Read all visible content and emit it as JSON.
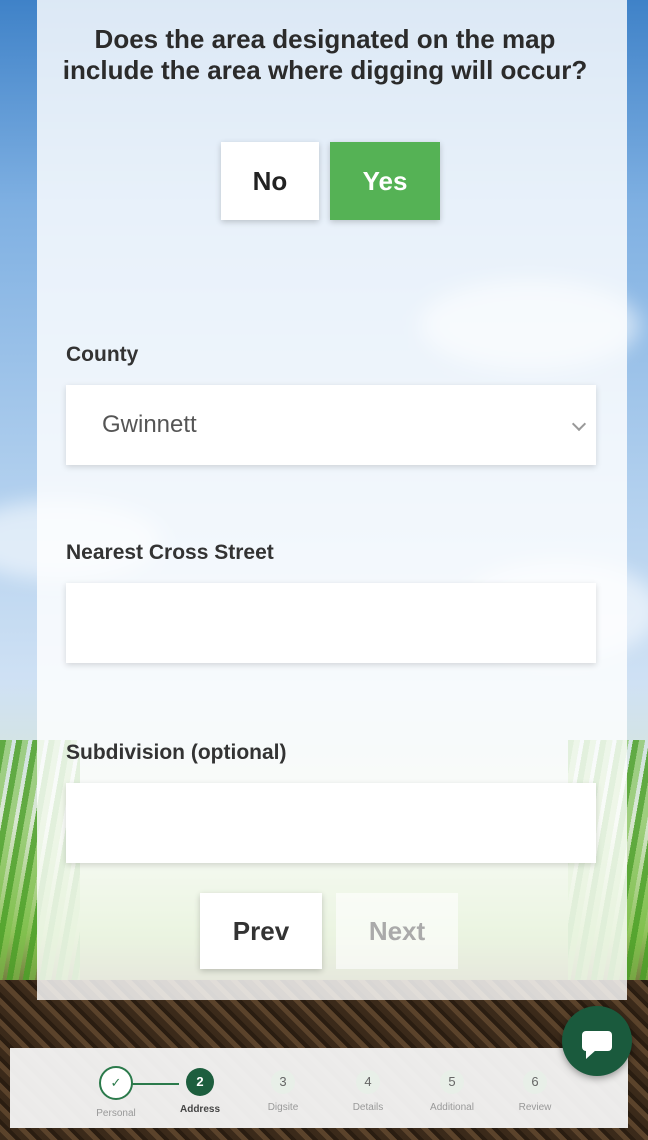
{
  "question": "Does the area designated on the map include the area where digging will occur?",
  "answer_buttons": {
    "no_label": "No",
    "yes_label": "Yes",
    "selected": "Yes"
  },
  "county": {
    "label": "County",
    "value": "Gwinnett"
  },
  "cross_street": {
    "label": "Nearest Cross Street",
    "value": "",
    "placeholder": ""
  },
  "subdivision": {
    "label": "Subdivision (optional)",
    "value": "",
    "placeholder": ""
  },
  "nav": {
    "prev_label": "Prev",
    "next_label": "Next"
  },
  "steps": [
    {
      "number": "",
      "name": "Personal",
      "state": "done"
    },
    {
      "number": "2",
      "name": "Address",
      "state": "active"
    },
    {
      "number": "3",
      "name": "Digsite",
      "state": "pending"
    },
    {
      "number": "4",
      "name": "Details",
      "state": "pending"
    },
    {
      "number": "5",
      "name": "Additional",
      "state": "pending"
    },
    {
      "number": "6",
      "name": "Review",
      "state": "pending"
    }
  ],
  "colors": {
    "yes_green": "#55b255",
    "step_dark_green": "#1d5e3e",
    "chat_green": "#1a5a3d"
  },
  "icons": {
    "chat": "chat-bubble-icon",
    "check": "check-icon",
    "chevron": "chevron-down-icon"
  }
}
